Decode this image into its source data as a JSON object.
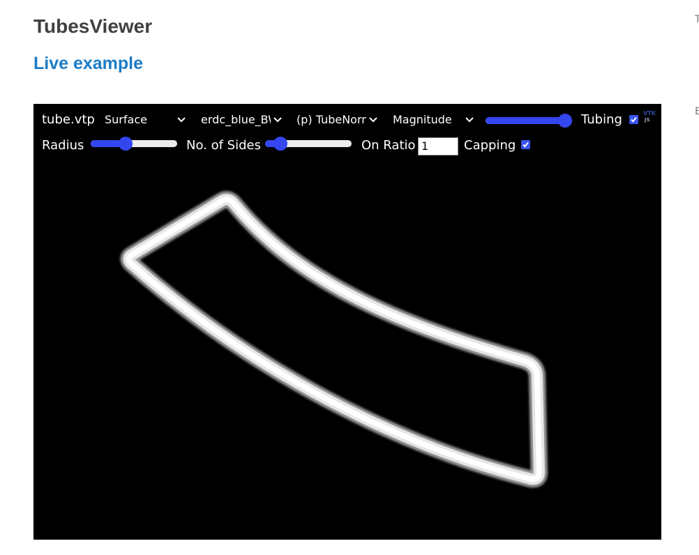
{
  "page": {
    "title": "TubesViewer",
    "live_example_link": "Live example",
    "edge_glyph_top": "T",
    "edge_glyph_mid": "E"
  },
  "viewer": {
    "file_name": "tube.vtp",
    "representation": "Surface",
    "color_preset": "erdc_blue_BW",
    "color_by": "(p) TubeNormals",
    "component": "Magnitude",
    "opacity": 1.0,
    "tubing_label": "Tubing",
    "tubing_checked": true,
    "radius_label": "Radius",
    "radius_value": 0.38,
    "sides_label": "No. of Sides",
    "sides_value": 0.12,
    "on_ratio_label": "On Ratio",
    "on_ratio_value": "1",
    "capping_label": "Capping",
    "capping_checked": true,
    "logo_text_top": "VTK",
    "logo_text_bottom": "JS"
  },
  "colors": {
    "title": "#404040",
    "link": "#1a7cc8",
    "viewer_background": "#000000",
    "slider_accent": "#3446f0",
    "checkbox_accent": "#3a54f2",
    "tube": "#ffffff"
  }
}
